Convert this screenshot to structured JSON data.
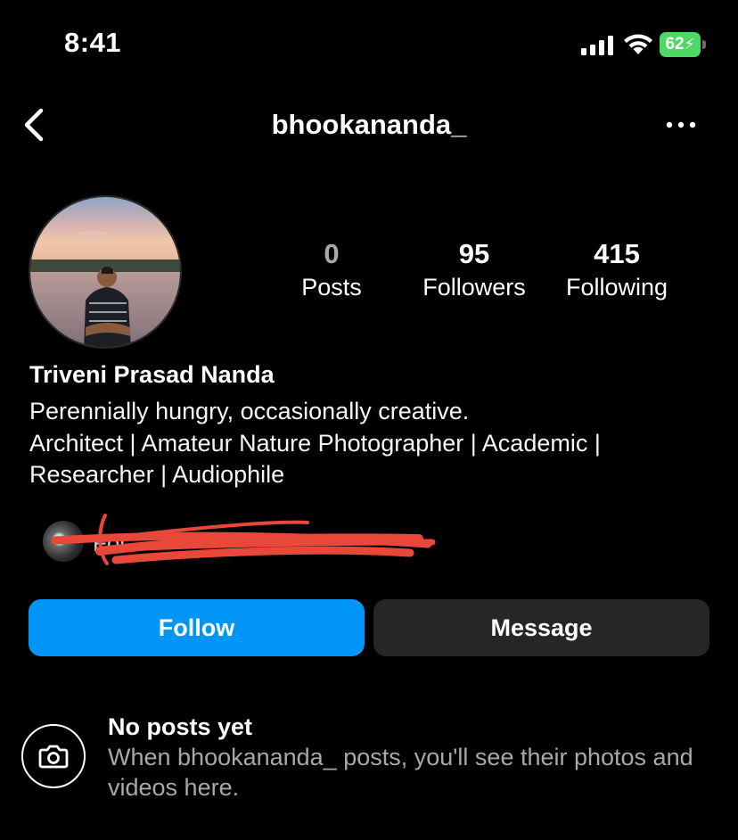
{
  "status_bar": {
    "time": "8:41",
    "battery_level": "62",
    "icons": [
      "cellular-signal-icon",
      "wifi-icon",
      "battery-charging-icon"
    ]
  },
  "header": {
    "username": "bhookananda_",
    "back_icon": "chevron-left-icon",
    "more_icon": "more-horizontal-icon"
  },
  "profile": {
    "avatar": "profile-photo",
    "stats": [
      {
        "count": "0",
        "label": "Posts"
      },
      {
        "count": "95",
        "label": "Followers"
      },
      {
        "count": "415",
        "label": "Following"
      }
    ],
    "display_name": "Triveni Prasad Nanda",
    "bio_lines": [
      "Perennially hungry, occasionally creative.",
      "Architect | Amateur Nature Photographer | Academic |",
      "Researcher | Audiophile"
    ],
    "followed_by_visible_text": "Fol",
    "followed_by_redacted": true
  },
  "actions": {
    "follow_label": "Follow",
    "message_label": "Message"
  },
  "empty_state": {
    "icon": "camera-icon",
    "title": "No posts yet",
    "description": "When bhookananda_ posts, you'll see their photos and videos here."
  },
  "colors": {
    "background": "#000000",
    "follow_button": "#0095f6",
    "message_button": "#262626",
    "secondary_text": "#a8a8a8",
    "battery": "#4cd964",
    "redaction": "#e8473a"
  }
}
